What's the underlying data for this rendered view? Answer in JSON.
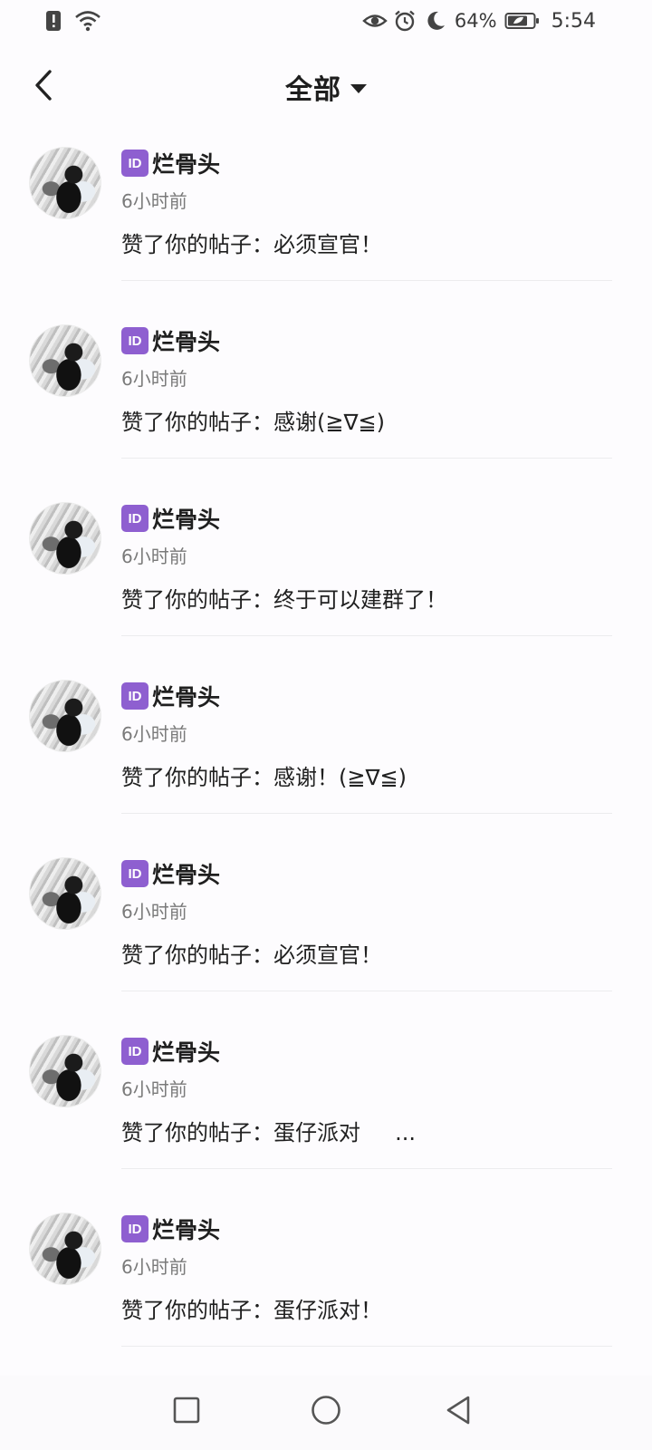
{
  "status_bar": {
    "battery_percent": "64%",
    "time": "5:54",
    "icons": [
      "alert-icon",
      "wifi-icon",
      "eye-icon",
      "alarm-icon",
      "moon-icon",
      "battery-icon"
    ]
  },
  "header": {
    "filter_label": "全部",
    "back_icon": "chevron-left-icon",
    "filter_icon": "caret-down-icon"
  },
  "notifications": [
    {
      "badge": "ID",
      "name": "烂骨头",
      "time": "6小时前",
      "message": "赞了你的帖子：必须宣官！"
    },
    {
      "badge": "ID",
      "name": "烂骨头",
      "time": "6小时前",
      "message": "赞了你的帖子：感谢(≧∇≦)"
    },
    {
      "badge": "ID",
      "name": "烂骨头",
      "time": "6小时前",
      "message": "赞了你的帖子：终于可以建群了！"
    },
    {
      "badge": "ID",
      "name": "烂骨头",
      "time": "6小时前",
      "message": "赞了你的帖子：感谢！(≧∇≦)"
    },
    {
      "badge": "ID",
      "name": "烂骨头",
      "time": "6小时前",
      "message": "赞了你的帖子：必须宣官！"
    },
    {
      "badge": "ID",
      "name": "烂骨头",
      "time": "6小时前",
      "message": "赞了你的帖子：蛋仔派对     ..."
    },
    {
      "badge": "ID",
      "name": "烂骨头",
      "time": "6小时前",
      "message": "赞了你的帖子：蛋仔派对！"
    }
  ],
  "nav_bar": {
    "recents_icon": "square-icon",
    "home_icon": "circle-icon",
    "back_icon": "triangle-back-icon"
  }
}
